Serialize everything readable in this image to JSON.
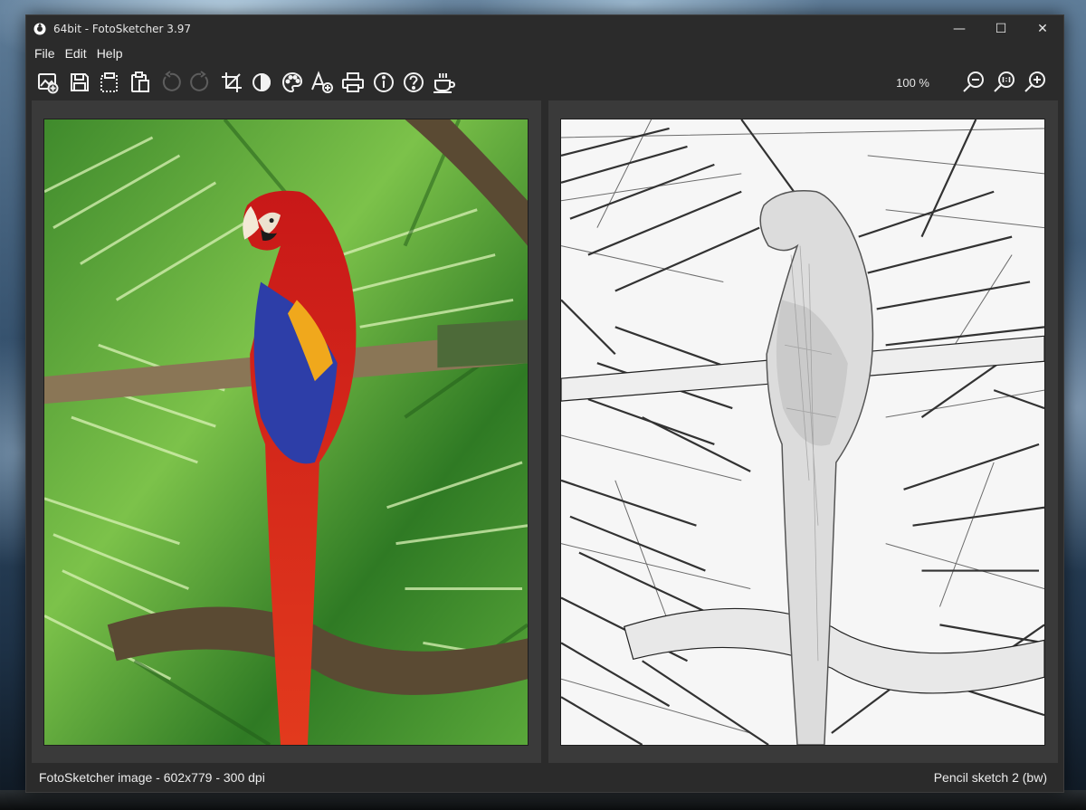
{
  "window": {
    "title": "64bit - FotoSketcher 3.97",
    "minimize_glyph": "—",
    "maximize_glyph": "☐",
    "close_glyph": "✕"
  },
  "menu": {
    "items": [
      "File",
      "Edit",
      "Help"
    ]
  },
  "toolbar": {
    "tools": [
      {
        "icon": "open-image-icon",
        "enabled": true
      },
      {
        "icon": "save-icon",
        "enabled": true
      },
      {
        "icon": "copy-icon",
        "enabled": true
      },
      {
        "icon": "paste-icon",
        "enabled": true
      },
      {
        "icon": "undo-icon",
        "enabled": false
      },
      {
        "icon": "redo-icon",
        "enabled": false
      },
      {
        "icon": "crop-icon",
        "enabled": true
      },
      {
        "icon": "contrast-icon",
        "enabled": true
      },
      {
        "icon": "palette-icon",
        "enabled": true
      },
      {
        "icon": "add-text-icon",
        "enabled": true
      },
      {
        "icon": "print-icon",
        "enabled": true
      },
      {
        "icon": "info-icon",
        "enabled": true
      },
      {
        "icon": "help-icon",
        "enabled": true
      },
      {
        "icon": "coffee-icon",
        "enabled": true
      }
    ],
    "zoom_level": "100 %"
  },
  "panels": {
    "source_image": "parrot-photo",
    "result_image": "parrot-pencil-sketch"
  },
  "status": {
    "left": "FotoSketcher image - 602x779 - 300 dpi",
    "right": "Pencil sketch 2 (bw)"
  },
  "colors": {
    "window_bg": "#2b2b2b",
    "panel_bg": "#3a3a3a",
    "text": "#ececec"
  }
}
